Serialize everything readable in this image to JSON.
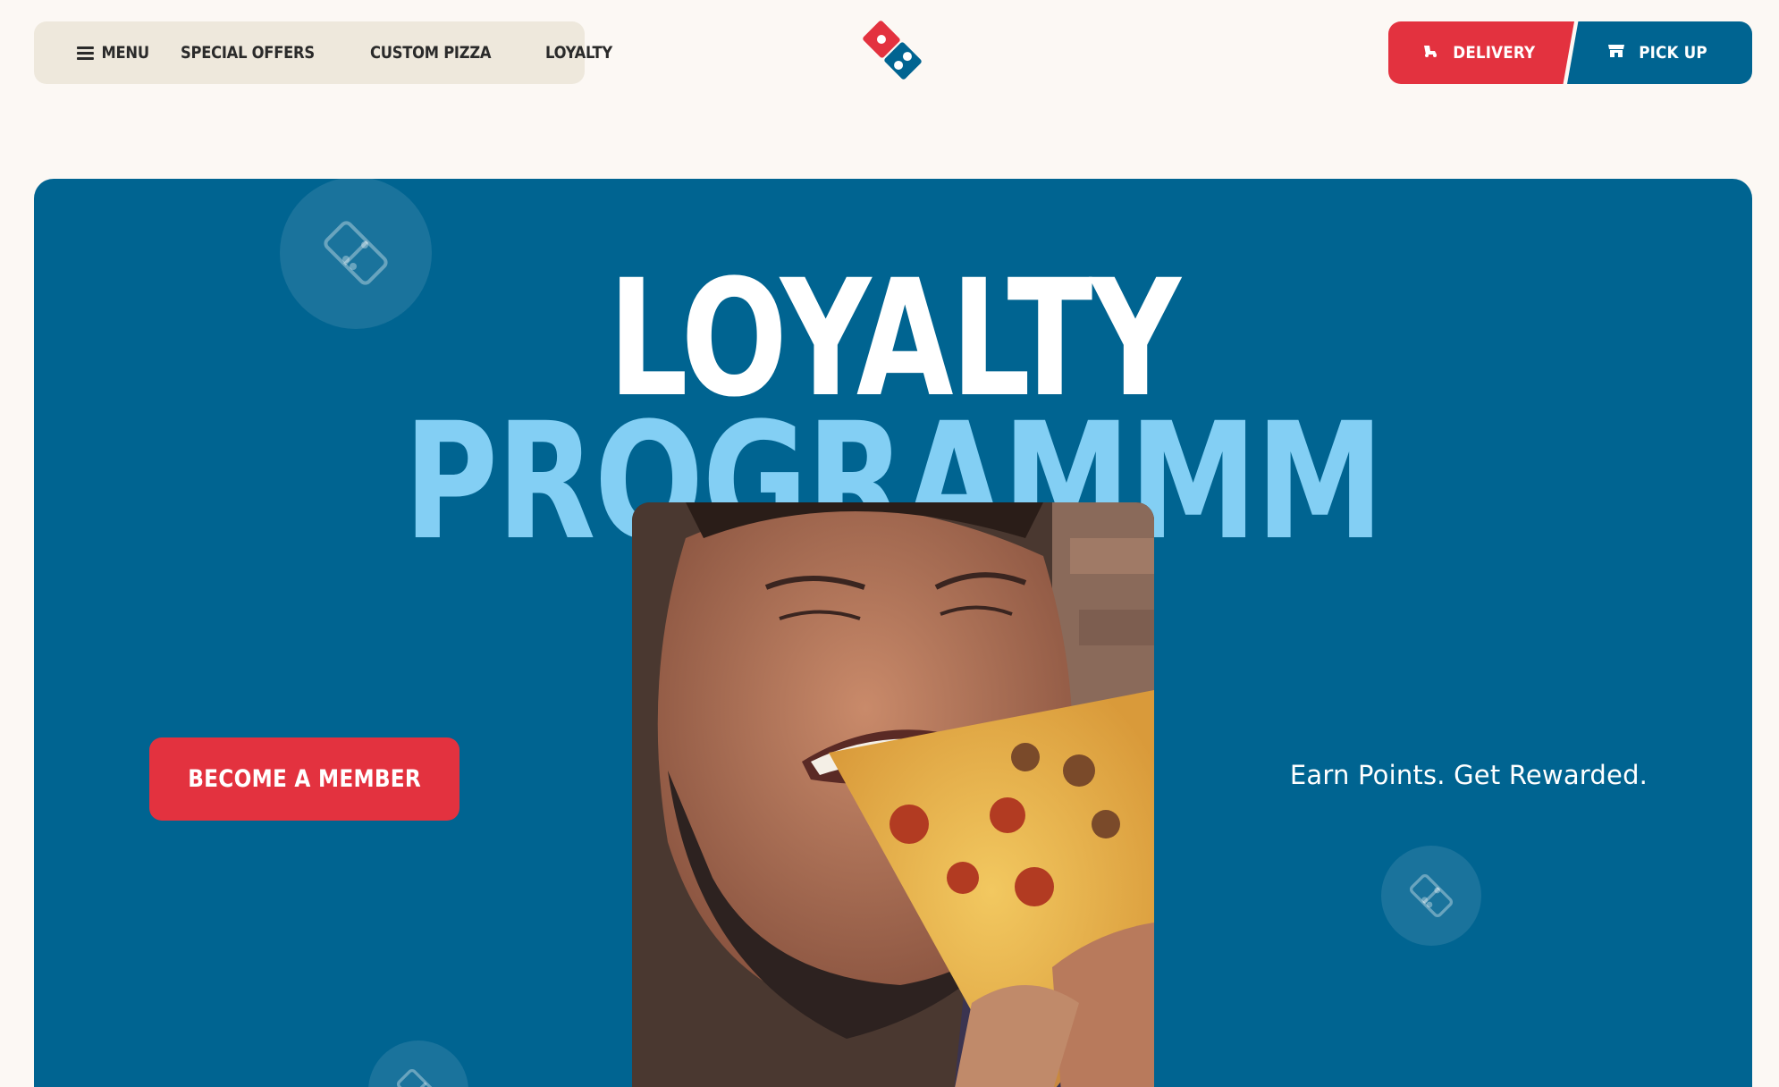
{
  "header": {
    "nav": {
      "menu_label": "MENU",
      "items": [
        "SPECIAL OFFERS",
        "CUSTOM PIZZA",
        "LOYALTY"
      ]
    },
    "logo_icon": "dominos-domino-logo-icon",
    "delivery_label": "DELIVERY",
    "pickup_label": "PICK UP"
  },
  "hero": {
    "title_line1": "LOYALTY",
    "title_line2": "PROGRAMMM",
    "cta_label": "BECOME A MEMBER",
    "tagline": "Earn Points. Get Rewarded.",
    "photo": "man-eating-pepperoni-pizza-slice"
  },
  "colors": {
    "brand_blue": "#006491",
    "brand_red": "#e3323f",
    "light_blue": "#83cff4",
    "nav_bg": "#eee8dc",
    "page_bg": "#fcf8f4"
  }
}
